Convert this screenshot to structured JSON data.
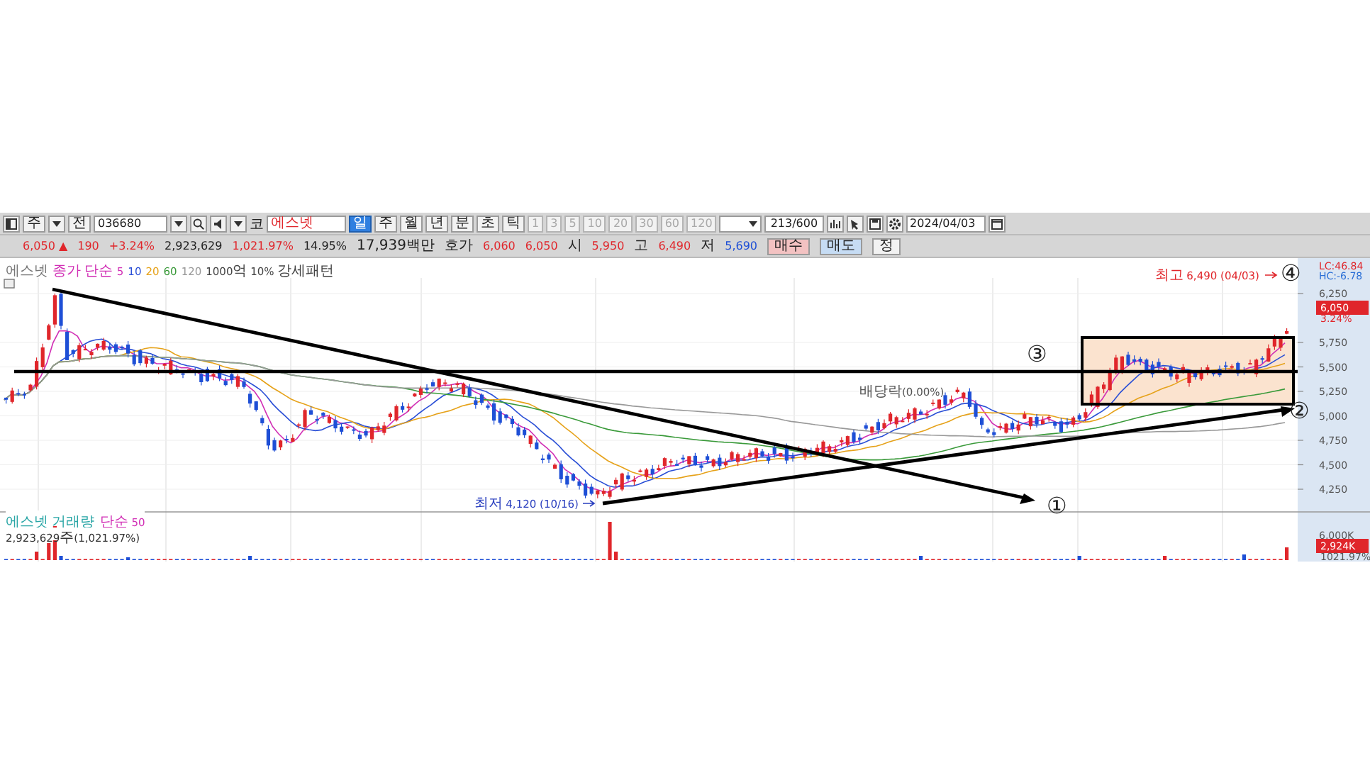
{
  "toolbar": {
    "market": "주",
    "type": "전",
    "code": "036680",
    "exchange": "코",
    "name": "에스넷",
    "periods": [
      {
        "label": "일",
        "selected": true
      },
      {
        "label": "주",
        "selected": false
      },
      {
        "label": "월",
        "selected": false
      },
      {
        "label": "년",
        "selected": false
      },
      {
        "label": "분",
        "selected": false
      },
      {
        "label": "초",
        "selected": false
      },
      {
        "label": "틱",
        "selected": false
      }
    ],
    "intervals": [
      {
        "label": "1",
        "disabled": true
      },
      {
        "label": "3",
        "disabled": true
      },
      {
        "label": "5",
        "disabled": true
      },
      {
        "label": "10",
        "disabled": true
      },
      {
        "label": "20",
        "disabled": true
      },
      {
        "label": "30",
        "disabled": true
      },
      {
        "label": "60",
        "disabled": true
      },
      {
        "label": "120",
        "disabled": true
      }
    ],
    "count": "213/600",
    "date": "2024/04/03"
  },
  "quote": {
    "items": [
      {
        "text": "6,050 ▲",
        "color": "#e0262b"
      },
      {
        "text": "190",
        "color": "#e0262b"
      },
      {
        "text": "+3.24%",
        "color": "#e0262b"
      },
      {
        "text": "2,923,629",
        "color": "#222222"
      },
      {
        "text": "1,021.97%",
        "color": "#e0262b"
      },
      {
        "text": "14.95%",
        "color": "#222222"
      },
      {
        "text": "17,939백만",
        "color": "#222222"
      },
      {
        "text": "호가",
        "color": "#222222"
      },
      {
        "text": "6,060",
        "color": "#e0262b"
      },
      {
        "text": "6,050",
        "color": "#e0262b"
      },
      {
        "text": "시",
        "color": "#222222"
      },
      {
        "text": "5,950",
        "color": "#e0262b"
      },
      {
        "text": "고",
        "color": "#222222"
      },
      {
        "text": "6,490",
        "color": "#e0262b"
      },
      {
        "text": "저",
        "color": "#222222"
      },
      {
        "text": "5,690",
        "color": "#1e4fd6"
      }
    ],
    "buttons": [
      {
        "label": "매수",
        "kind": "buy"
      },
      {
        "label": "매도",
        "kind": "sell"
      },
      {
        "label": "정",
        "kind": "plain"
      }
    ]
  },
  "chart": {
    "legend": [
      {
        "text": "에스넷",
        "color": "#777777"
      },
      {
        "text": "종가 단순",
        "color": "#d12fb5"
      },
      {
        "text": "5",
        "color": "#d12fb5"
      },
      {
        "text": "10",
        "color": "#2a4fd6"
      },
      {
        "text": "20",
        "color": "#e6a21a"
      },
      {
        "text": "60",
        "color": "#3a9a3a"
      },
      {
        "text": "120",
        "color": "#999999"
      },
      {
        "text": "1000억 10% 강세패턴",
        "color": "#444444"
      }
    ],
    "lc": "LC:46.84",
    "hc": "HC:-6.78",
    "price_ticks": [
      "6,250",
      "5,750",
      "5,500",
      "5,250",
      "5,000",
      "4,750",
      "4,500",
      "4,250"
    ],
    "price_tag": "6,050",
    "change_tag": "3.24%",
    "high_note": "최고 6,490 (04/03)",
    "low_note": "최저 4,120 (10/16)",
    "dividend_note": "배당락(0.00%)",
    "markers": [
      "①",
      "②",
      "③",
      "④"
    ]
  },
  "volume": {
    "title": "에스넷 거래량",
    "ma": "단순 50",
    "summary": "2,923,629주(1,021.97%)",
    "tick": "6,000K",
    "tag": "2,924K",
    "ratio": "1021.97%"
  }
}
